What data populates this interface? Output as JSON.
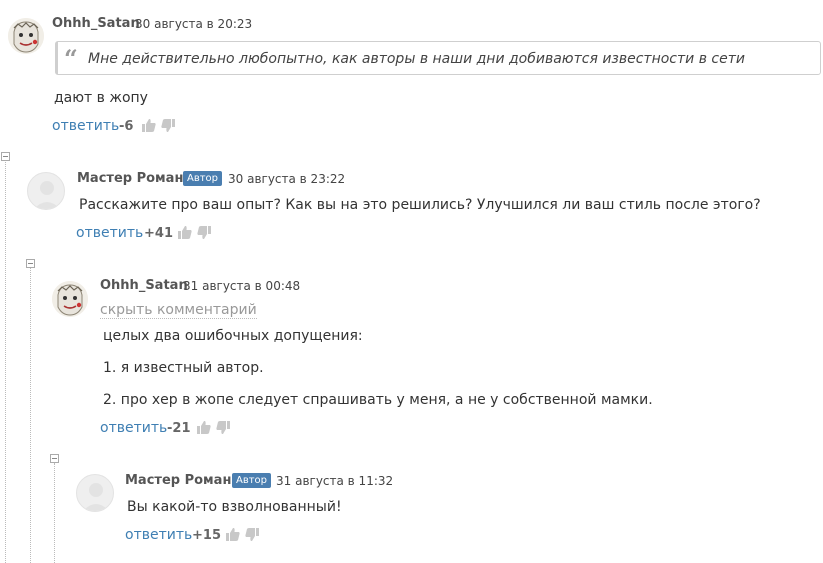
{
  "comments": [
    {
      "author": "Ohhh_Satan",
      "date": "30 августа в 20:23",
      "quote": "Мне действительно любопытно, как авторы в наши дни добиваются известности в сети",
      "lines": [
        "дают в жопу"
      ],
      "reply": "ответить",
      "score": "-6"
    },
    {
      "author": "Мастер Романов",
      "badge": "Автор",
      "date": "30 августа в 23:22",
      "lines": [
        "Расскажите про ваш опыт? Как вы на это решились? Улучшился ли ваш стиль после этого?"
      ],
      "reply": "ответить",
      "score": "+41"
    },
    {
      "author": "Ohhh_Satan",
      "date": "31 августа в 00:48",
      "hide": "скрыть комментарий",
      "lines": [
        "целых два ошибочных допущения:",
        "1. я известный автор.",
        "2. про хер в жопе следует спрашивать у меня, а не у собственной мамки."
      ],
      "reply": "ответить",
      "score": "-21"
    },
    {
      "author": "Мастер Романов",
      "badge": "Автор",
      "date": "31 августа в 11:32",
      "lines": [
        "Вы какой-то взволнованный!"
      ],
      "reply": "ответить",
      "score": "+15"
    }
  ],
  "icons": {
    "thumb_up": "thumbs-up-icon",
    "thumb_down": "thumbs-down-icon",
    "collapse": "collapse-icon"
  },
  "colors": {
    "link": "#3f7fb3",
    "badge": "#4a7eb0",
    "muted": "#999999"
  }
}
